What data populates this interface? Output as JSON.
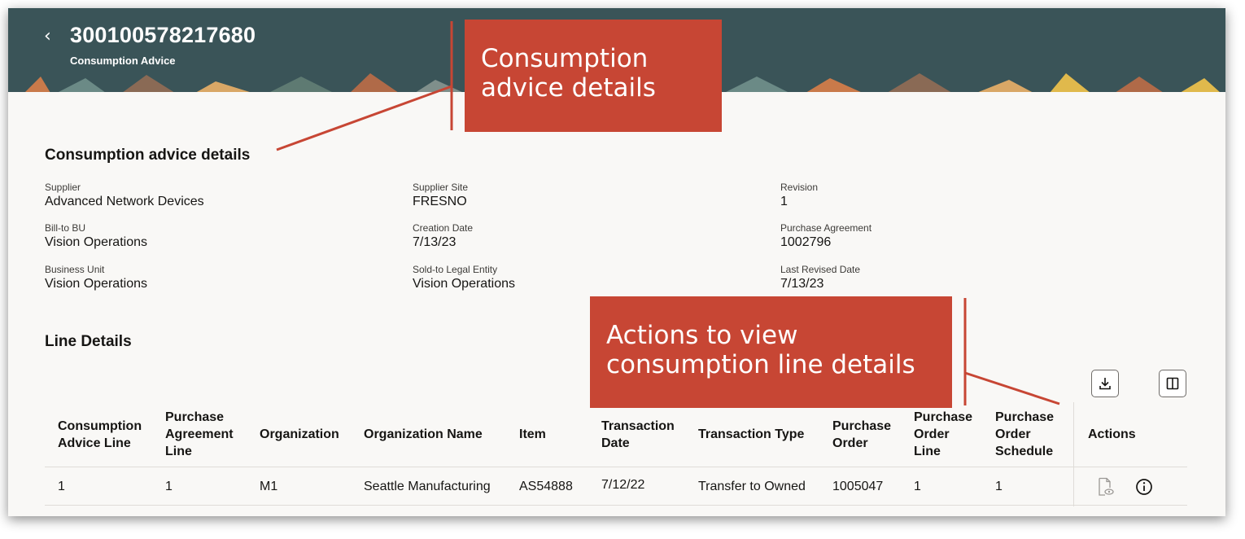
{
  "header": {
    "title": "300100578217680",
    "subtitle": "Consumption Advice"
  },
  "details": {
    "section_title": "Consumption advice details",
    "fields": [
      {
        "label": "Supplier",
        "value": "Advanced Network Devices"
      },
      {
        "label": "Supplier Site",
        "value": "FRESNO"
      },
      {
        "label": "Revision",
        "value": "1"
      },
      {
        "label": "Bill-to BU",
        "value": "Vision Operations"
      },
      {
        "label": "Creation Date",
        "value": "7/13/23"
      },
      {
        "label": "Purchase Agreement",
        "value": "1002796"
      },
      {
        "label": "Business Unit",
        "value": "Vision Operations"
      },
      {
        "label": "Sold-to Legal Entity",
        "value": "Vision Operations"
      },
      {
        "label": "Last Revised Date",
        "value": "7/13/23"
      }
    ]
  },
  "lines": {
    "section_title": "Line Details",
    "toolbar": {
      "download_icon": "download-icon",
      "columns_icon": "columns-icon"
    },
    "columns": [
      "Consumption Advice Line",
      "Purchase Agreement Line",
      "Organization",
      "Organization Name",
      "Item",
      "Transaction Date",
      "Transaction Type",
      "Purchase Order",
      "Purchase Order Line",
      "Purchase Order Schedule",
      "Actions"
    ],
    "rows": [
      {
        "cells": [
          "1",
          "1",
          "M1",
          "Seattle Manufacturing",
          "AS54888",
          "7/12/22",
          "Transfer to Owned",
          "1005047",
          "1",
          "1"
        ],
        "action_icons": [
          "view-document-icon",
          "info-icon"
        ]
      }
    ]
  },
  "callouts": {
    "advice": "Consumption advice details",
    "actions": "Actions to view consumption line details"
  },
  "colors": {
    "header_bg": "#3a5458",
    "callout_bg": "#c74634",
    "page_bg": "#f9f8f6"
  }
}
